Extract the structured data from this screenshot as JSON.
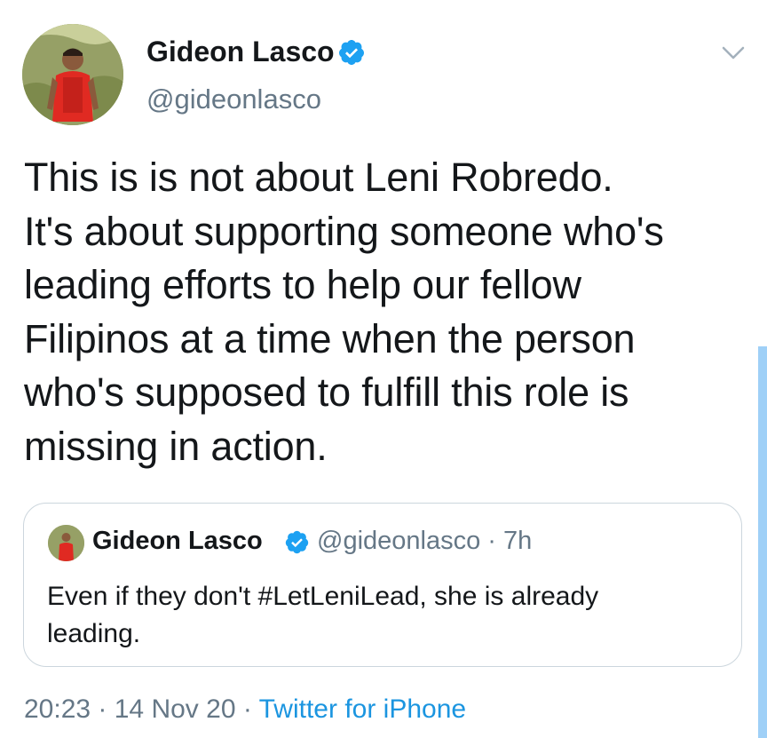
{
  "tweet": {
    "author": {
      "display_name": "Gideon Lasco",
      "handle": "@gideonlasco",
      "verified": true
    },
    "text_lines": [
      "This is is not about Leni Robredo.",
      "It's about supporting someone who's",
      "leading efforts to help our fellow",
      "Filipinos at a time when the person",
      "who's supposed to fulfill this role is",
      "missing in action."
    ],
    "quoted": {
      "display_name": "Gideon Lasco",
      "handle": "@gideonlasco",
      "separator": " · ",
      "time_ago": "7h",
      "text_lines": [
        "Even if they don't #LetLeniLead, she is already",
        "leading."
      ]
    },
    "footer": {
      "time": "20:23",
      "separator": " · ",
      "date": "14 Nov 20",
      "source": "Twitter for iPhone"
    }
  },
  "colors": {
    "text": "#14171a",
    "secondary": "#657786",
    "accent": "#1b95e0",
    "verified": "#1da1f2",
    "border": "#ccd6dd"
  },
  "icons": {
    "verified": "verified-badge-icon",
    "menu": "chevron-down-icon"
  }
}
